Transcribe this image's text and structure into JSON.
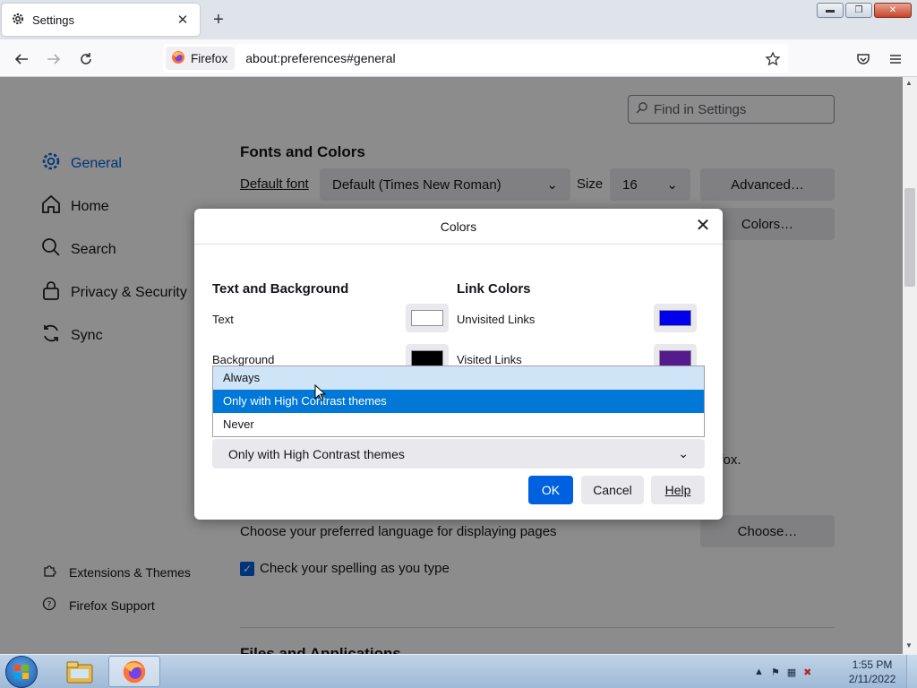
{
  "browser": {
    "tab_title": "Settings",
    "identity_label": "Firefox",
    "url": "about:preferences#general"
  },
  "sidebar": {
    "items": [
      {
        "label": "General",
        "icon": "gear-icon",
        "selected": true
      },
      {
        "label": "Home",
        "icon": "home-icon"
      },
      {
        "label": "Search",
        "icon": "search-icon"
      },
      {
        "label": "Privacy & Security",
        "icon": "lock-icon"
      },
      {
        "label": "Sync",
        "icon": "sync-icon"
      }
    ],
    "footer": [
      {
        "label": "Extensions & Themes",
        "icon": "puzzle-icon"
      },
      {
        "label": "Firefox Support",
        "icon": "help-icon"
      }
    ]
  },
  "search": {
    "placeholder": "Find in Settings"
  },
  "fonts": {
    "section_title": "Fonts and Colors",
    "default_font_label": "Default font",
    "default_font_value": "Default (Times New Roman)",
    "size_label": "Size",
    "size_value": "16",
    "advanced_button": "Advanced…",
    "colors_button": "Colors…"
  },
  "background_text": {
    "firefox_fragment": "efox.",
    "language_text": "Choose your preferred language for displaying pages",
    "choose_button": "Choose…",
    "spellcheck_label": "Check your spelling as you type",
    "next_section_fragment": "Files and Applications"
  },
  "dialog": {
    "title": "Colors",
    "text_bg_title": "Text and Background",
    "text_label": "Text",
    "background_label": "Background",
    "link_colors_title": "Link Colors",
    "unvisited_label": "Unvisited Links",
    "visited_label": "Visited Links",
    "colors": {
      "text": "#ffffff",
      "background": "#000000",
      "unvisited": "#0000ee",
      "visited": "#551a8b"
    },
    "override_options": [
      "Always",
      "Only with High Contrast themes",
      "Never"
    ],
    "override_selected": "Only with High Contrast themes",
    "ok": "OK",
    "cancel": "Cancel",
    "help": "Help"
  },
  "taskbar": {
    "time": "1:55 PM",
    "date": "2/11/2022"
  },
  "theme": {
    "accent": "#0061e0",
    "selection": "#0078d7"
  }
}
